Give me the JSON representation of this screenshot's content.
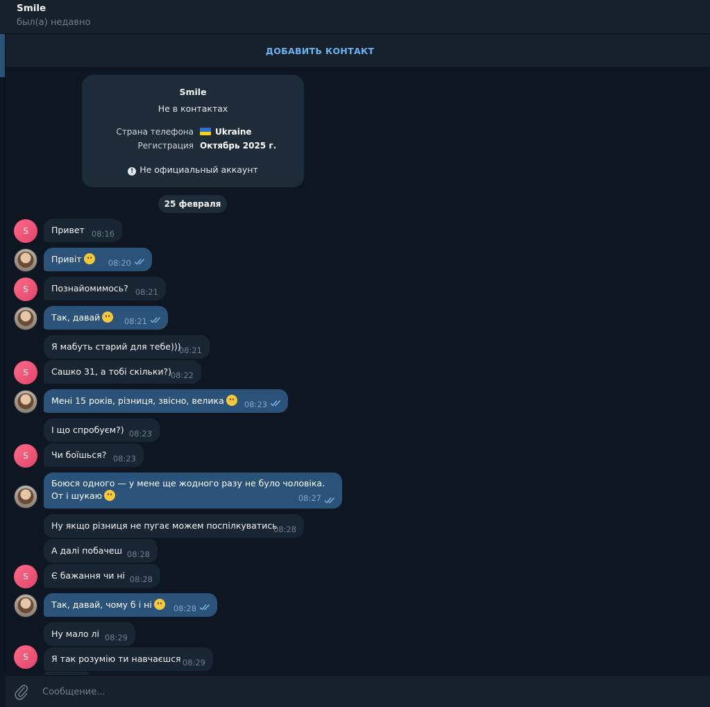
{
  "header": {
    "title": "Smile",
    "status": "был(а) недавно"
  },
  "add_contact_label": "ДОБАВИТЬ КОНТАКТ",
  "card": {
    "name": "Smile",
    "subtitle": "Не в контактах",
    "phone_country_label": "Страна телефона",
    "phone_country_value": "Ukraine",
    "registration_label": "Регистрация",
    "registration_value": "Октябрь 2025 г.",
    "warning": "Не официальный аккаунт"
  },
  "date_separator": "25 февраля",
  "avatar_initial": "S",
  "colors": {
    "accent": "#6ab3f3",
    "incoming": "#182533",
    "outgoing": "#2b5278",
    "background": "#0e1621"
  },
  "messages": [
    {
      "text": "Привет",
      "time": "08:16"
    },
    {
      "text": "Привіт",
      "time": "08:20"
    },
    {
      "text": "Познайомимось?",
      "time": "08:21"
    },
    {
      "text": "Так, давай",
      "time": "08:21"
    },
    {
      "text": "Я мабуть старий для тебе)))",
      "time": "08:21"
    },
    {
      "text": "Сашко 31, а тобі скільки?)",
      "time": "08:22"
    },
    {
      "text": "Мені 15 років, різниця, звісно, велика",
      "time": "08:23"
    },
    {
      "text": "І що спробуєм?)",
      "time": "08:23"
    },
    {
      "text": "Чи боїшься?",
      "time": "08:23"
    },
    {
      "text": "Боюся одного — у мене ще жодного разу не було чоловіка. От і шукаю",
      "time": "08:27"
    },
    {
      "text": "Ну якщо різниця не пугає можем поспілкуватись",
      "time": "08:28"
    },
    {
      "text": "А далі побачеш",
      "time": "08:28"
    },
    {
      "text": "Є бажання чи ні",
      "time": "08:28"
    },
    {
      "text": "Так, давай, чому б і ні",
      "time": "08:28"
    },
    {
      "text": "Ну мало лі",
      "time": "08:29"
    },
    {
      "text": "Я так розумію ти навчаєшся",
      "time": "08:29"
    }
  ],
  "composer": {
    "placeholder": "Сообщение..."
  }
}
